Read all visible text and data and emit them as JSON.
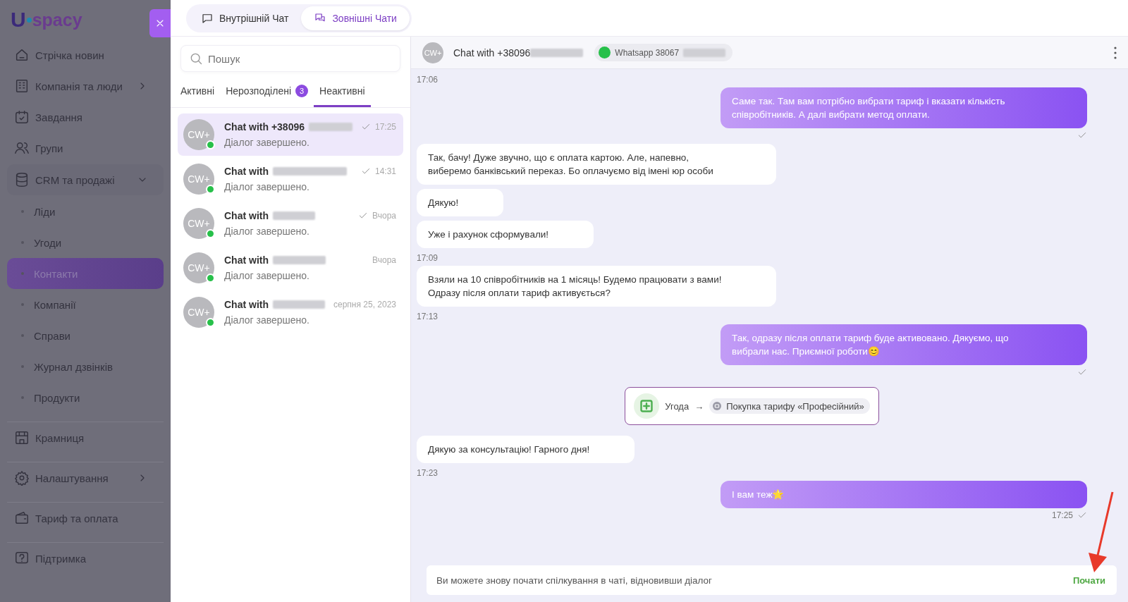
{
  "sidebar": {
    "logo": {
      "letter": "U",
      "text": "spacy"
    },
    "items": [
      {
        "label": "Стрічка новин",
        "selected": false
      },
      {
        "label": "Компанія та люди",
        "selected": false,
        "expanded": false
      },
      {
        "label": "Завдання",
        "selected": false
      },
      {
        "label": "Групи",
        "selected": false
      },
      {
        "label": "CRM та продажі",
        "selected": false,
        "expanded": true,
        "children": [
          {
            "label": "Ліди",
            "selected": false
          },
          {
            "label": "Угоди",
            "selected": false
          },
          {
            "label": "Контакти",
            "selected": true
          },
          {
            "label": "Компанії",
            "selected": false
          },
          {
            "label": "Справи",
            "selected": false
          },
          {
            "label": "Журнал дзвінків",
            "selected": false
          },
          {
            "label": "Продукти",
            "selected": false
          }
        ]
      },
      {
        "label": "Крамниця",
        "selected": false,
        "divider": true
      },
      {
        "label": "Налаштування",
        "selected": false,
        "expanded": false,
        "divider": true
      },
      {
        "label": "Тариф та оплата",
        "selected": false,
        "divider": true
      },
      {
        "label": "Підтримка",
        "selected": false,
        "divider": true
      }
    ]
  },
  "top_tabs": [
    {
      "label": "Внутрішній Чат",
      "selected": false
    },
    {
      "label": "Зовнішні Чати",
      "selected": true
    }
  ],
  "chat_list": {
    "search": {
      "placeholder": "Пошук"
    },
    "tabs": [
      {
        "label": "Активні",
        "selected": false
      },
      {
        "label": "Нерозподілені",
        "badge": "3",
        "selected": false
      },
      {
        "label": "Неактивні",
        "selected": true
      }
    ],
    "chats": [
      {
        "avatar": "CW+",
        "title": "Chat with +38096",
        "preview": "Діалог завершено.",
        "time": "17:25",
        "read": true,
        "selected": true
      },
      {
        "avatar": "CW+",
        "title": "Chat with",
        "preview": "Діалог завершено.",
        "time": "14:31",
        "read": true,
        "selected": false
      },
      {
        "avatar": "CW+",
        "title": "Chat with",
        "preview": "Діалог завершено.",
        "time": "Вчора",
        "read": true,
        "selected": false
      },
      {
        "avatar": "CW+",
        "title": "Chat with",
        "preview": "Діалог завершено.",
        "time": "Вчора",
        "read": false,
        "selected": false
      },
      {
        "avatar": "CW+",
        "title": "Chat with",
        "preview": "Діалог завершено.",
        "time": "серпня 25, 2023",
        "read": false,
        "selected": false
      }
    ]
  },
  "chat": {
    "header": {
      "avatar": "CW+",
      "title": "Chat with +38096",
      "channel": "Whatsapp 38067"
    },
    "messages": [
      {
        "kind": "time",
        "text": "17:06"
      },
      {
        "kind": "out",
        "text": "Саме так. Там вам потрібно вибрати тариф і вказати кількість співробітників. А далі вибрати метод оплати.",
        "read": true
      },
      {
        "kind": "in",
        "text": "Так, бачу! Дуже звучно, що є оплата картою. Але, напевно, виберемо банківський переказ. Бо оплачуємо від імені юр особи"
      },
      {
        "kind": "in",
        "text": "Дякую!"
      },
      {
        "kind": "in",
        "text": "Уже і рахунок сформували!"
      },
      {
        "kind": "time",
        "text": "17:09"
      },
      {
        "kind": "in",
        "text": "Взяли на 10 співробітників на 1 місяць! Будемо працювати з вами! Одразу після оплати тариф активується?"
      },
      {
        "kind": "time",
        "text": "17:13"
      },
      {
        "kind": "out",
        "text": "Так, одразу після оплати тариф буде активовано. Дякуємо, що вибрали нас. Приємної роботи😊",
        "read": true
      },
      {
        "kind": "event",
        "entity": "Угода",
        "arrow": "→",
        "target": "Покупка тарифу «Професійний»"
      },
      {
        "kind": "in",
        "text": "Дякую за консультацію! Гарного дня!"
      },
      {
        "kind": "time",
        "text": "17:23"
      },
      {
        "kind": "out",
        "text": "І вам теж🌟",
        "time": "17:25",
        "read": true
      }
    ],
    "footer": {
      "text": "Ви можете знову почати спілкування в чаті, відновивши діалог",
      "action": "Почати"
    }
  }
}
